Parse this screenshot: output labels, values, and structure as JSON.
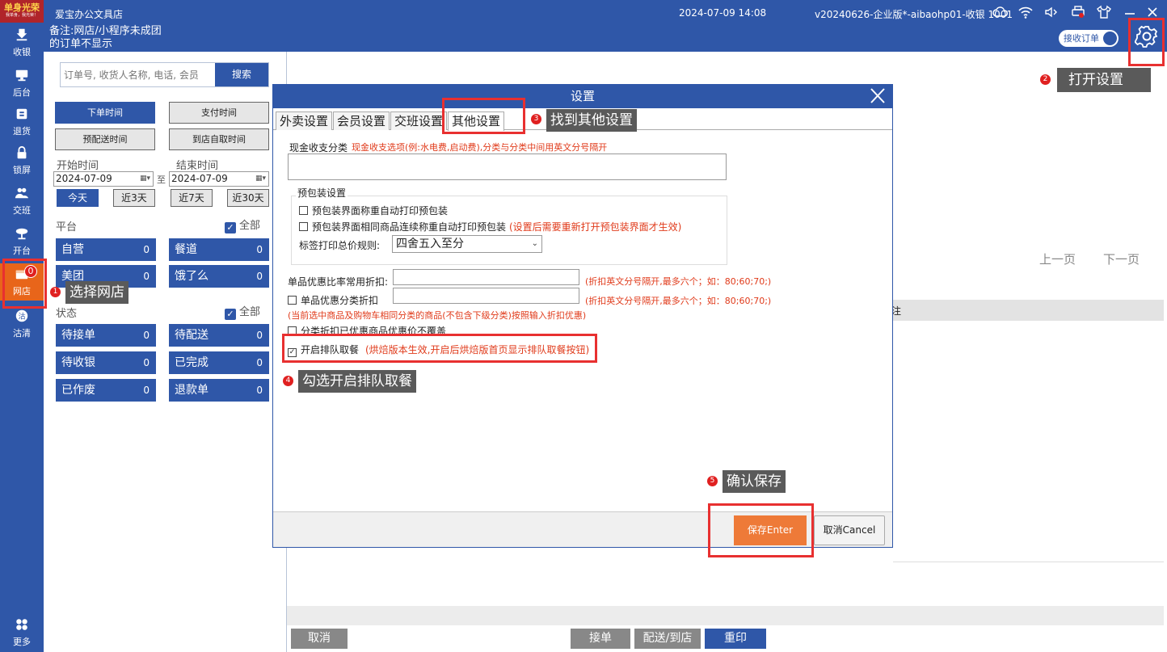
{
  "logo": {
    "text": "单身光荣",
    "sub": "我单身，我光荣！"
  },
  "sidebar": {
    "items": [
      {
        "label": "收银",
        "icon": "download-icon"
      },
      {
        "label": "后台",
        "icon": "monitor-icon"
      },
      {
        "label": "退货",
        "icon": "return-icon"
      },
      {
        "label": "锁屏",
        "icon": "lock-icon"
      },
      {
        "label": "交班",
        "icon": "users-icon"
      },
      {
        "label": "开台",
        "icon": "dining-icon"
      },
      {
        "label": "网店",
        "icon": "shop-icon",
        "badge": "0"
      },
      {
        "label": "沽清",
        "icon": "sold-out-icon"
      },
      {
        "label": "更多",
        "icon": "grid-icon"
      }
    ]
  },
  "header": {
    "store_name": "爱宝办公文具店",
    "note_line1": "备注:网店/小程序未成团",
    "note_line2": "的订单不显示",
    "datetime": "2024-07-09 14:08",
    "version": "v20240626-企业版*-aibaohp01-收银 1001",
    "receive_orders": "接收订单"
  },
  "search": {
    "placeholder": "订单号, 收货人名称, 电话, 会员",
    "button": "搜索"
  },
  "time_filters": [
    "下单时间",
    "支付时间",
    "预配送时间",
    "到店自取时间"
  ],
  "date_range": {
    "start_label": "开始时间",
    "end_label": "结束时间",
    "start": "2024-07-09",
    "end": "2024-07-09",
    "sep": "至"
  },
  "quick_ranges": [
    "今天",
    "近3天",
    "近7天",
    "近30天"
  ],
  "platform": {
    "label": "平台",
    "all": "全部",
    "items": [
      {
        "label": "自营",
        "count": "0"
      },
      {
        "label": "餐道",
        "count": "0"
      },
      {
        "label": "美团",
        "count": "0"
      },
      {
        "label": "饿了么",
        "count": "0"
      }
    ]
  },
  "status": {
    "label": "状态",
    "all": "全部",
    "items": [
      {
        "label": "待接单",
        "count": "0"
      },
      {
        "label": "待配送",
        "count": "0"
      },
      {
        "label": "待收银",
        "count": "0"
      },
      {
        "label": "已完成",
        "count": "0"
      },
      {
        "label": "已作废",
        "count": "0"
      },
      {
        "label": "退款单",
        "count": "0"
      }
    ]
  },
  "pager": {
    "prev": "上一页",
    "next": "下一页"
  },
  "grid": {
    "col": "注"
  },
  "bottom_actions": [
    "取消",
    "接单",
    "配送/到店",
    "重印"
  ],
  "dialog": {
    "title": "设置",
    "tabs": [
      "外卖设置",
      "会员设置",
      "交班设置",
      "其他设置"
    ],
    "cash_label": "现金收支分类",
    "cash_hint": "现金收支选项(例:水电费,启动费),分类与分类中间用英文分号隔开",
    "prepack": {
      "title": "预包装设置",
      "opt1": "预包装界面称重自动打印预包装",
      "opt2": "预包装界面相同商品连续称重自动打印预包装",
      "opt2_hint": "(设置后需要重新打开预包装界面才生效)",
      "rule_label": "标签打印总价规则:",
      "rule_value": "四舍五入至分"
    },
    "discount_label": "单品优惠比率常用折扣:",
    "discount_hint": "(折扣英文分号隔开,最多六个；如：80;60;70;)",
    "cat_discount_label": "单品优惠分类折扣",
    "cat_discount_hint": "(折扣英文分号隔开,最多六个；如：80;60;70;)",
    "cat_note": "(当前选中商品及购物车相同分类的商品(不包含下级分类)按照输入折扣优惠)",
    "no_override": "分类折扣已优惠商品优惠价不覆盖",
    "queue_label": "开启排队取餐",
    "queue_hint": "(烘焙版本生效,开启后烘焙版首页显示排队取餐按钮)",
    "save": "保存Enter",
    "cancel": "取消Cancel"
  },
  "tips": {
    "step1": "选择网店",
    "n1": "1",
    "step2": "打开设置",
    "n2": "2",
    "step3": "找到其他设置",
    "n3": "3",
    "step4": "勾选开启排队取餐",
    "n4": "4",
    "step5": "确认保存",
    "n5": "5"
  },
  "colors": {
    "primary": "#2f57a8",
    "accent": "#e8651a",
    "highlight": "#e83030",
    "save": "#ee7a38"
  }
}
